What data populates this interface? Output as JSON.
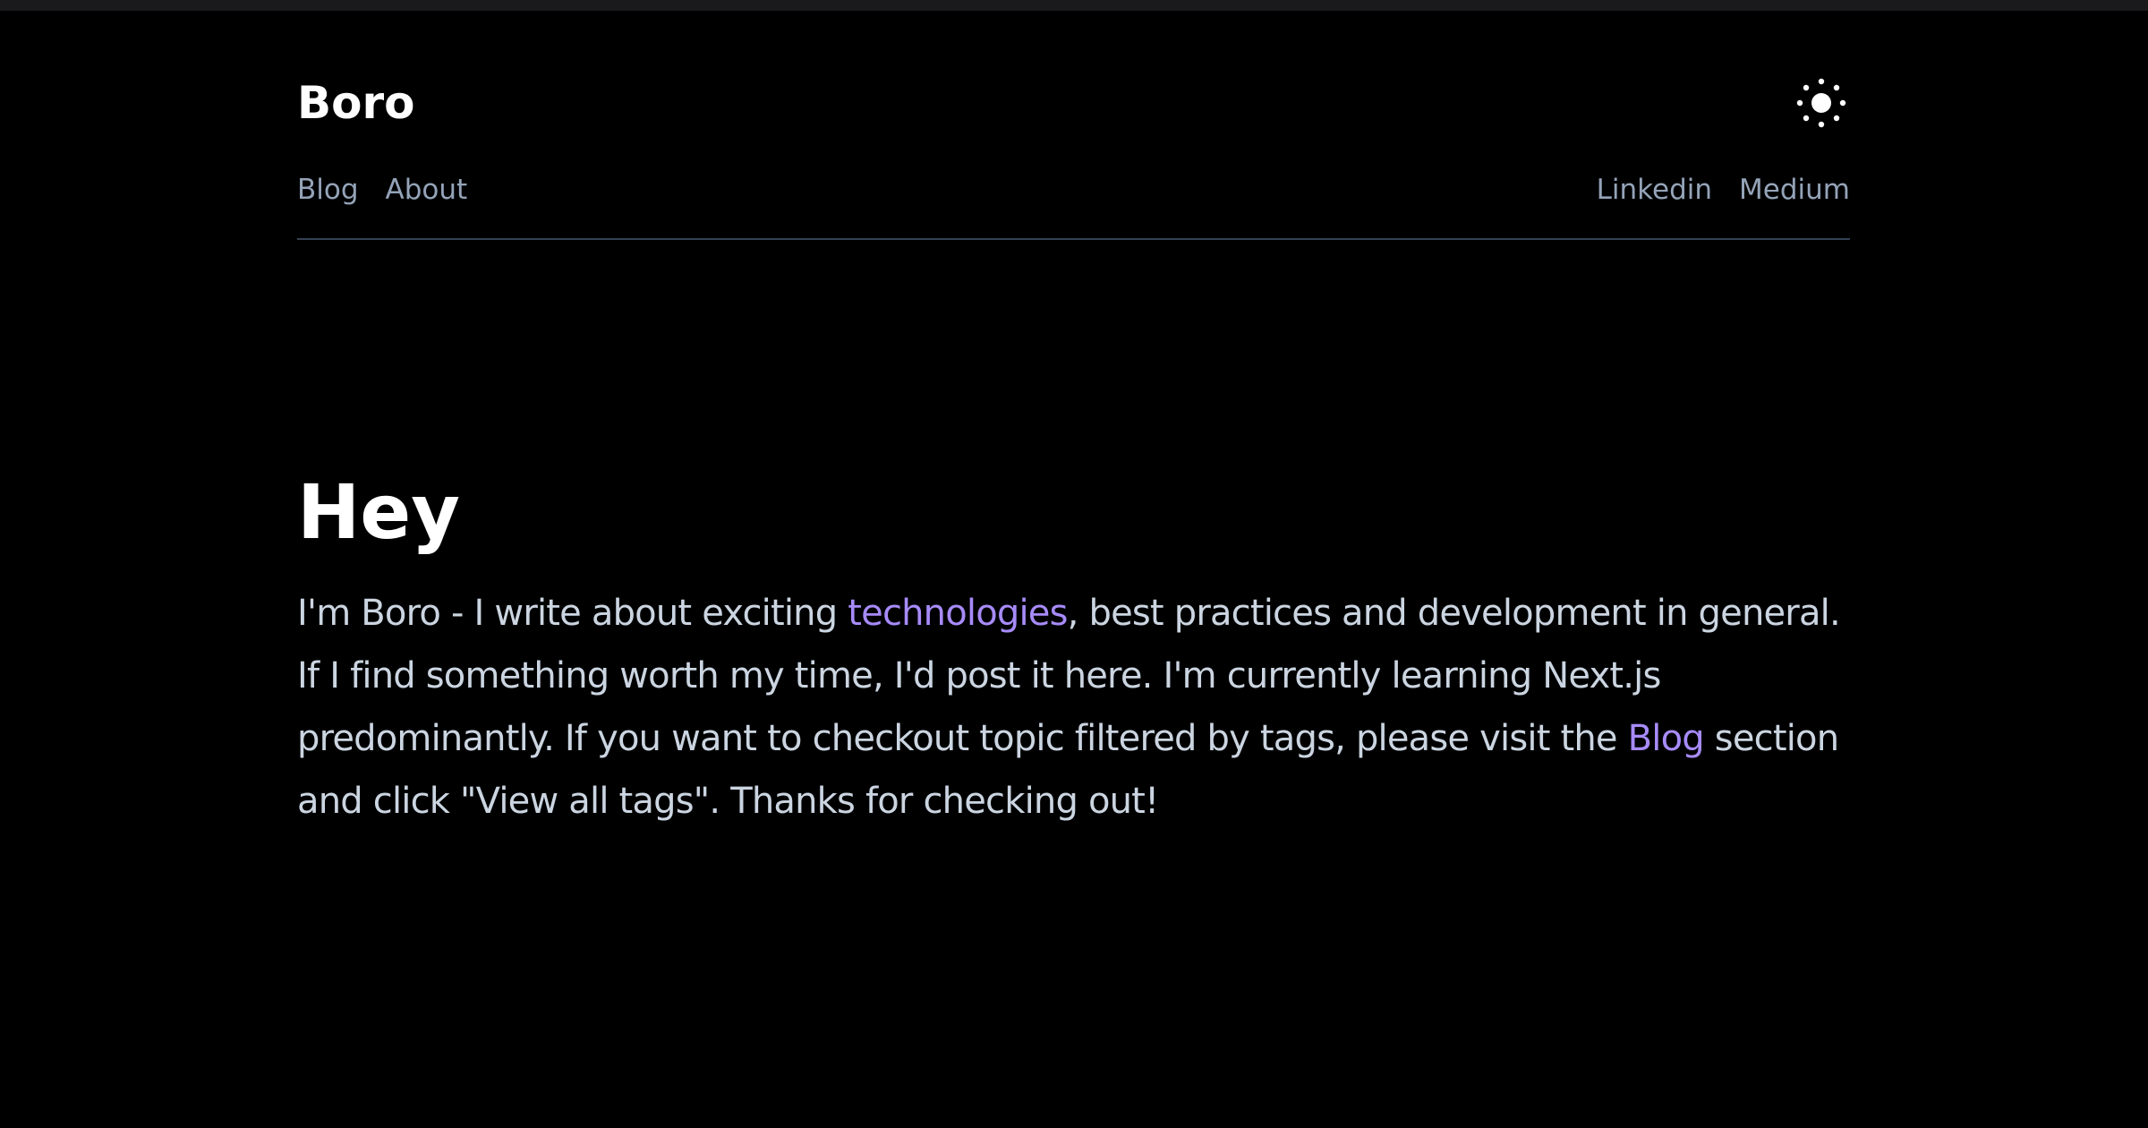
{
  "header": {
    "site_title": "Boro",
    "theme_toggle_icon": "sun-icon"
  },
  "nav": {
    "left": [
      {
        "label": "Blog"
      },
      {
        "label": "About"
      }
    ],
    "right": [
      {
        "label": "Linkedin"
      },
      {
        "label": "Medium"
      }
    ]
  },
  "intro": {
    "heading": "Hey",
    "text_1": "I'm Boro - I write about exciting ",
    "link_technologies": "technologies",
    "text_2": ", best practices and development in general. If I find something worth my time, I'd post it here. I'm currently learning Next.js predominantly. If you want to checkout topic filtered by tags, please visit the ",
    "link_blog": "Blog",
    "text_3": " section and click \"View all tags\". Thanks for checking out!"
  },
  "colors": {
    "background": "#000000",
    "title": "#ffffff",
    "nav_link": "#94a3b8",
    "body_text": "#cbd5e1",
    "accent_link": "#a78bfa",
    "divider": "#334155"
  }
}
